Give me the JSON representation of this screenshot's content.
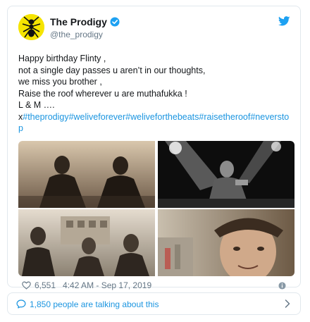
{
  "account": {
    "display_name": "The Prodigy",
    "handle": "@the_prodigy"
  },
  "tweet": {
    "lines": [
      "Happy birthday Flinty ,",
      "not a single day passes u aren’t in our thoughts,",
      "we miss you brother ,",
      "Raise the roof wherever u are muthafukka !",
      "L & M …."
    ],
    "tag_prefix": "x",
    "hashtags": "#theprodigy#weliveforever#weliveforthebeats#raisetheroof#neverstop"
  },
  "stats": {
    "likes": "6,551",
    "timestamp": "4:42 AM - Sep 17, 2019"
  },
  "conversation": {
    "label": "1,850 people are talking about this"
  },
  "colors": {
    "link": "#1b95e0",
    "secondary_text": "#657786",
    "border": "#e1e8ed",
    "avatar_bg": "#f5e400"
  }
}
